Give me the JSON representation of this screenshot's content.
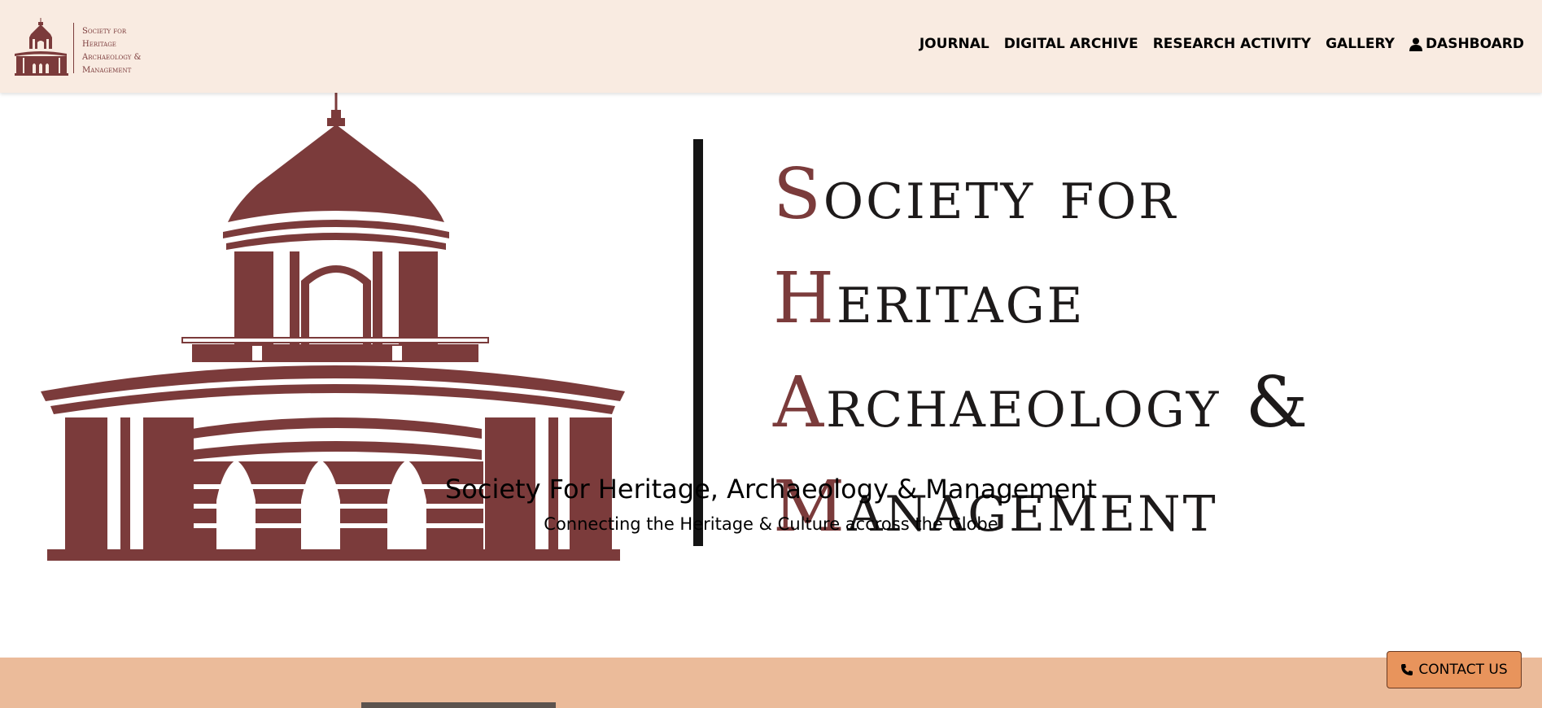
{
  "header": {
    "logo_lines": [
      "Society for",
      "Heritage",
      "Archaeology &",
      "Management"
    ],
    "nav": [
      {
        "label": "JOURNAL"
      },
      {
        "label": "DIGITAL ARCHIVE"
      },
      {
        "label": "RESEARCH ACTIVITY"
      },
      {
        "label": "GALLERY"
      },
      {
        "label": "DASHBOARD",
        "icon": "user-icon"
      }
    ]
  },
  "hero": {
    "title_lines": [
      {
        "cap": "S",
        "rest": "ociety for"
      },
      {
        "cap": "H",
        "rest": "eritage"
      },
      {
        "cap": "A",
        "rest": "rchaeology &"
      },
      {
        "cap": "M",
        "rest": "anagement"
      }
    ],
    "subtitle": "Society For Heritage, Archaeology & Management",
    "tagline": "Connecting the Heritage & Culture accross the Globe"
  },
  "contact": {
    "label": "CONTACT US",
    "icon": "phone-icon"
  },
  "colors": {
    "brand": "#7b3b3b",
    "header_bg": "#f9ebe1",
    "band": "#ebbb9a",
    "contact_bg": "#e8945c"
  }
}
